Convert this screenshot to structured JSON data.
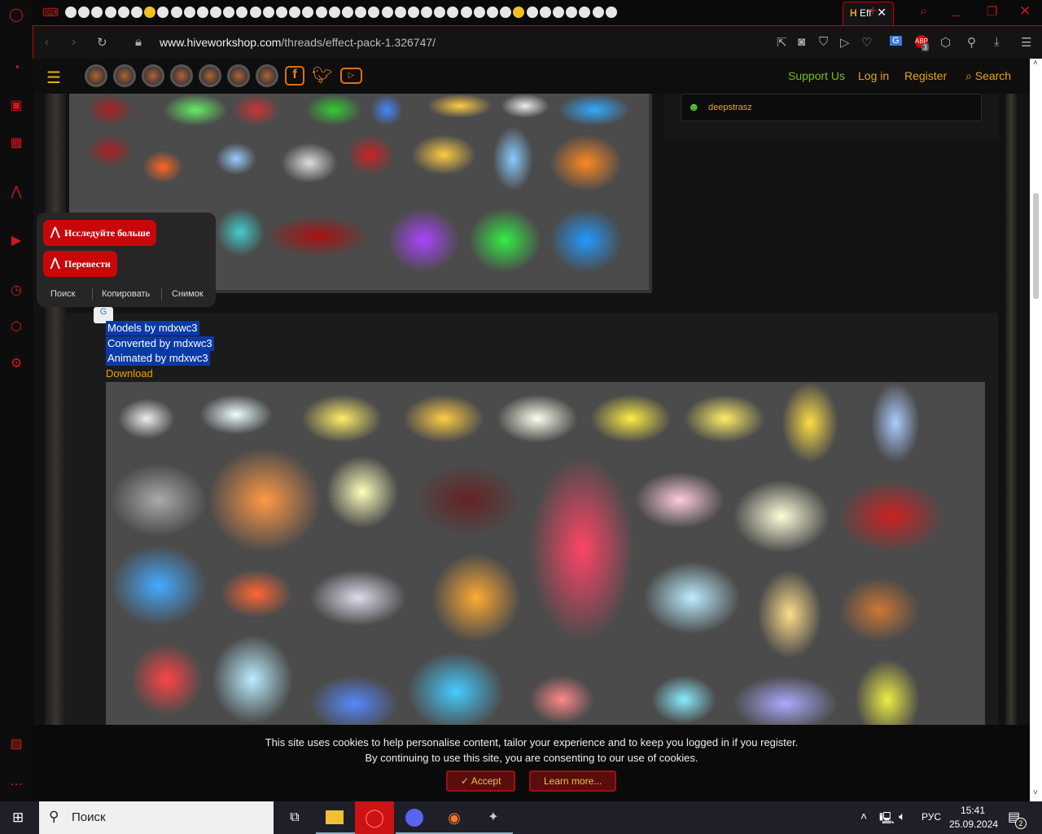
{
  "browser": {
    "active_tab_title": "Eff",
    "url_domain": "www.hiveworkshop.com",
    "url_path": "/threads/effect-pack-1.326747/",
    "extension_badge": "3"
  },
  "site": {
    "nav": {
      "support": "Support Us",
      "login": "Log in",
      "register": "Register",
      "search": "Search"
    },
    "sidebar_user": "deepstrasz",
    "post": {
      "lines": [
        "Models by mdxwc3",
        "Converted by mdxwc3",
        "Animated by mdxwc3"
      ],
      "download": "Download"
    }
  },
  "popup": {
    "explore": "Исследуйте больше",
    "translate": "Перевести",
    "actions": [
      "Поиск",
      "Копировать",
      "Снимок"
    ]
  },
  "cookie": {
    "line1": "This site uses cookies to help personalise content, tailor your experience and to keep you logged in if you register.",
    "line2": "By continuing to use this site, you are consenting to our use of cookies.",
    "accept": "Accept",
    "learn": "Learn more..."
  },
  "taskbar": {
    "search_placeholder": "Поиск",
    "lang": "РУС",
    "time": "15:41",
    "date": "25.09.2024",
    "notifications": "2"
  }
}
